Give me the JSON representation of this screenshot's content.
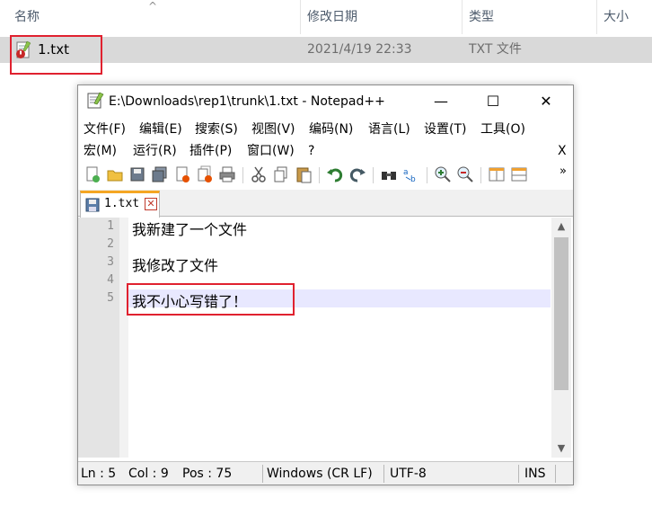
{
  "explorer": {
    "columns": [
      "名称",
      "修改日期",
      "类型",
      "大小"
    ],
    "sort_indicator": "^",
    "file": {
      "name": "1.txt",
      "modified": "2021/4/19 22:33",
      "type": "TXT 文件"
    }
  },
  "notepad": {
    "title": "E:\\Downloads\\rep1\\trunk\\1.txt - Notepad++",
    "window_buttons": {
      "minimize": "—",
      "maximize": "☐",
      "close": "✕"
    },
    "menu_row1": [
      "文件(F)",
      "编辑(E)",
      "搜索(S)",
      "视图(V)",
      "编码(N)",
      "语言(L)",
      "设置(T)",
      "工具(O)"
    ],
    "menu_row2": [
      "宏(M)",
      "运行(R)",
      "插件(P)",
      "窗口(W)",
      "?"
    ],
    "menu_close": "X",
    "toolbar_overflow": "»",
    "tab": {
      "label": "1.txt",
      "close": "✕"
    },
    "lines": [
      {
        "num": "1",
        "text": "我新建了一个文件"
      },
      {
        "num": "2",
        "text": ""
      },
      {
        "num": "3",
        "text": "我修改了文件"
      },
      {
        "num": "4",
        "text": ""
      },
      {
        "num": "5",
        "text": "我不小心写错了！"
      }
    ],
    "scroll_up": "▲",
    "scroll_down": "▼",
    "status": {
      "ln": "Ln : 5",
      "col": "Col : 9",
      "pos": "Pos : 75",
      "eol": "Windows (CR LF)",
      "encoding": "UTF-8",
      "mode": "INS"
    }
  },
  "colors": {
    "highlight_box": "#e0212f",
    "tab_accent": "#f5a623",
    "current_line": "#e8e8ff"
  }
}
